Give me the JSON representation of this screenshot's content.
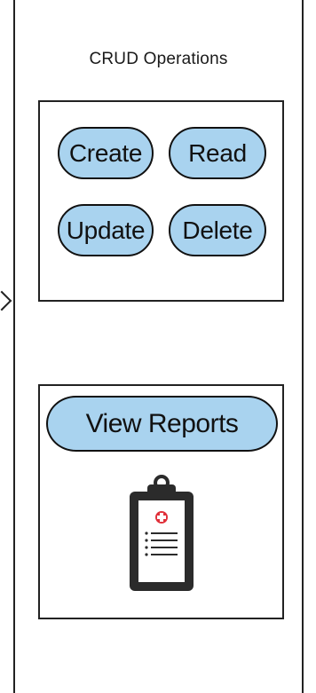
{
  "panel": {
    "title": "CRUD Operations"
  },
  "crud_buttons": {
    "create": "Create",
    "read": "Read",
    "update": "Update",
    "delete": "Delete"
  },
  "reports": {
    "button_label": "View Reports",
    "icon": "clipboard-medical-icon"
  },
  "colors": {
    "button_fill": "#a9d3ef",
    "border": "#111111",
    "clipboard_body": "#2b2b2b",
    "clipboard_paper": "#ffffff",
    "medical_cross": "#e0303a"
  }
}
